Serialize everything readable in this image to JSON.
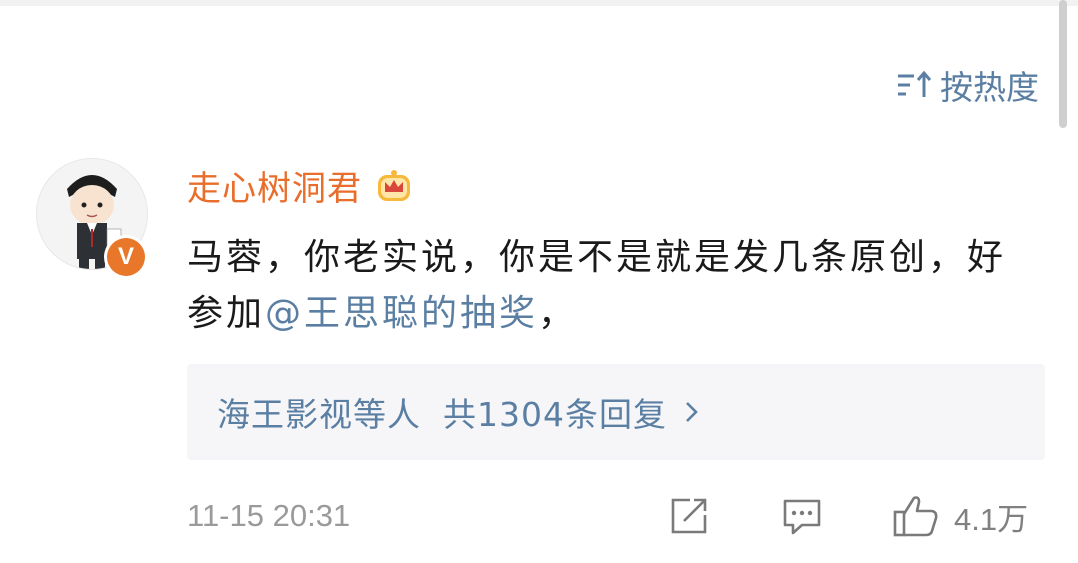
{
  "sort": {
    "label": "按热度",
    "icon": "sort-icon"
  },
  "comment": {
    "username": "走心树洞君",
    "verified_badge": "V",
    "text_before": "马蓉，你老实说，你是不是就是发几条原创，好参加",
    "mention": "@王思聪的抽奖",
    "text_after": "，",
    "timestamp": "11-15 20:31",
    "like_count": "4.1万"
  },
  "replies": {
    "participants": "海王影视等人",
    "count_text": "共1304条回复"
  },
  "colors": {
    "username": "#e96d2b",
    "link": "#5b7fa3",
    "badge": "#e9772a",
    "reply_bg": "#f6f6f8",
    "meta": "#9a9a9a"
  }
}
